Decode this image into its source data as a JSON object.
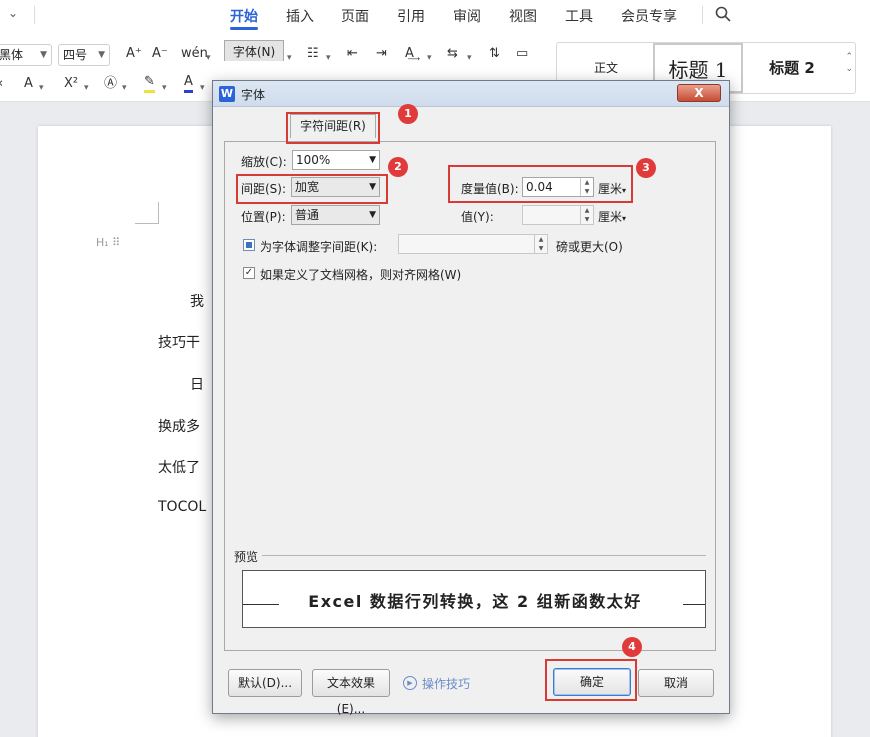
{
  "ribbon": {
    "tabs": [
      "开始",
      "插入",
      "页面",
      "引用",
      "审阅",
      "视图",
      "工具",
      "会员专享"
    ],
    "active_tab": "开始",
    "font_name": "黑体",
    "font_size": "四号",
    "accent_color": "#2b63d8",
    "styles": [
      "正文",
      "标题 1",
      "标题 2"
    ]
  },
  "document": {
    "lines": [
      "我",
      "技巧干",
      "日",
      "换成多",
      "太低了",
      "TOCOL"
    ]
  },
  "dialog": {
    "title": "字体",
    "app_icon": "W",
    "close_label": "X",
    "tabs": [
      "字体(N)",
      "字符间距(R)"
    ],
    "active_tab": "字符间距(R)",
    "scale": {
      "label": "缩放(C):",
      "value": "100%"
    },
    "spacing": {
      "label": "间距(S):",
      "value": "加宽"
    },
    "position": {
      "label": "位置(P):",
      "value": "普通"
    },
    "measure": {
      "label": "度量值(B):",
      "value": "0.04",
      "unit": "厘米"
    },
    "value2": {
      "label": "值(Y):",
      "value": "",
      "unit": "厘米"
    },
    "kerning": {
      "label": "为字体调整字间距(K):",
      "value": "",
      "suffix": "磅或更大(O)",
      "checked": false
    },
    "grid_align": {
      "label": "如果定义了文档网格，则对齐网格(W)",
      "checked": true
    },
    "preview": {
      "label": "预览",
      "text": "Excel 数据行列转换，这 2 组新函数太好"
    },
    "buttons": {
      "default": "默认(D)...",
      "text_effects": "文本效果(E)...",
      "tips": "操作技巧",
      "ok": "确定",
      "cancel": "取消"
    }
  },
  "annotations": {
    "badges": [
      "1",
      "2",
      "3",
      "4"
    ],
    "color": "#d83a35"
  }
}
